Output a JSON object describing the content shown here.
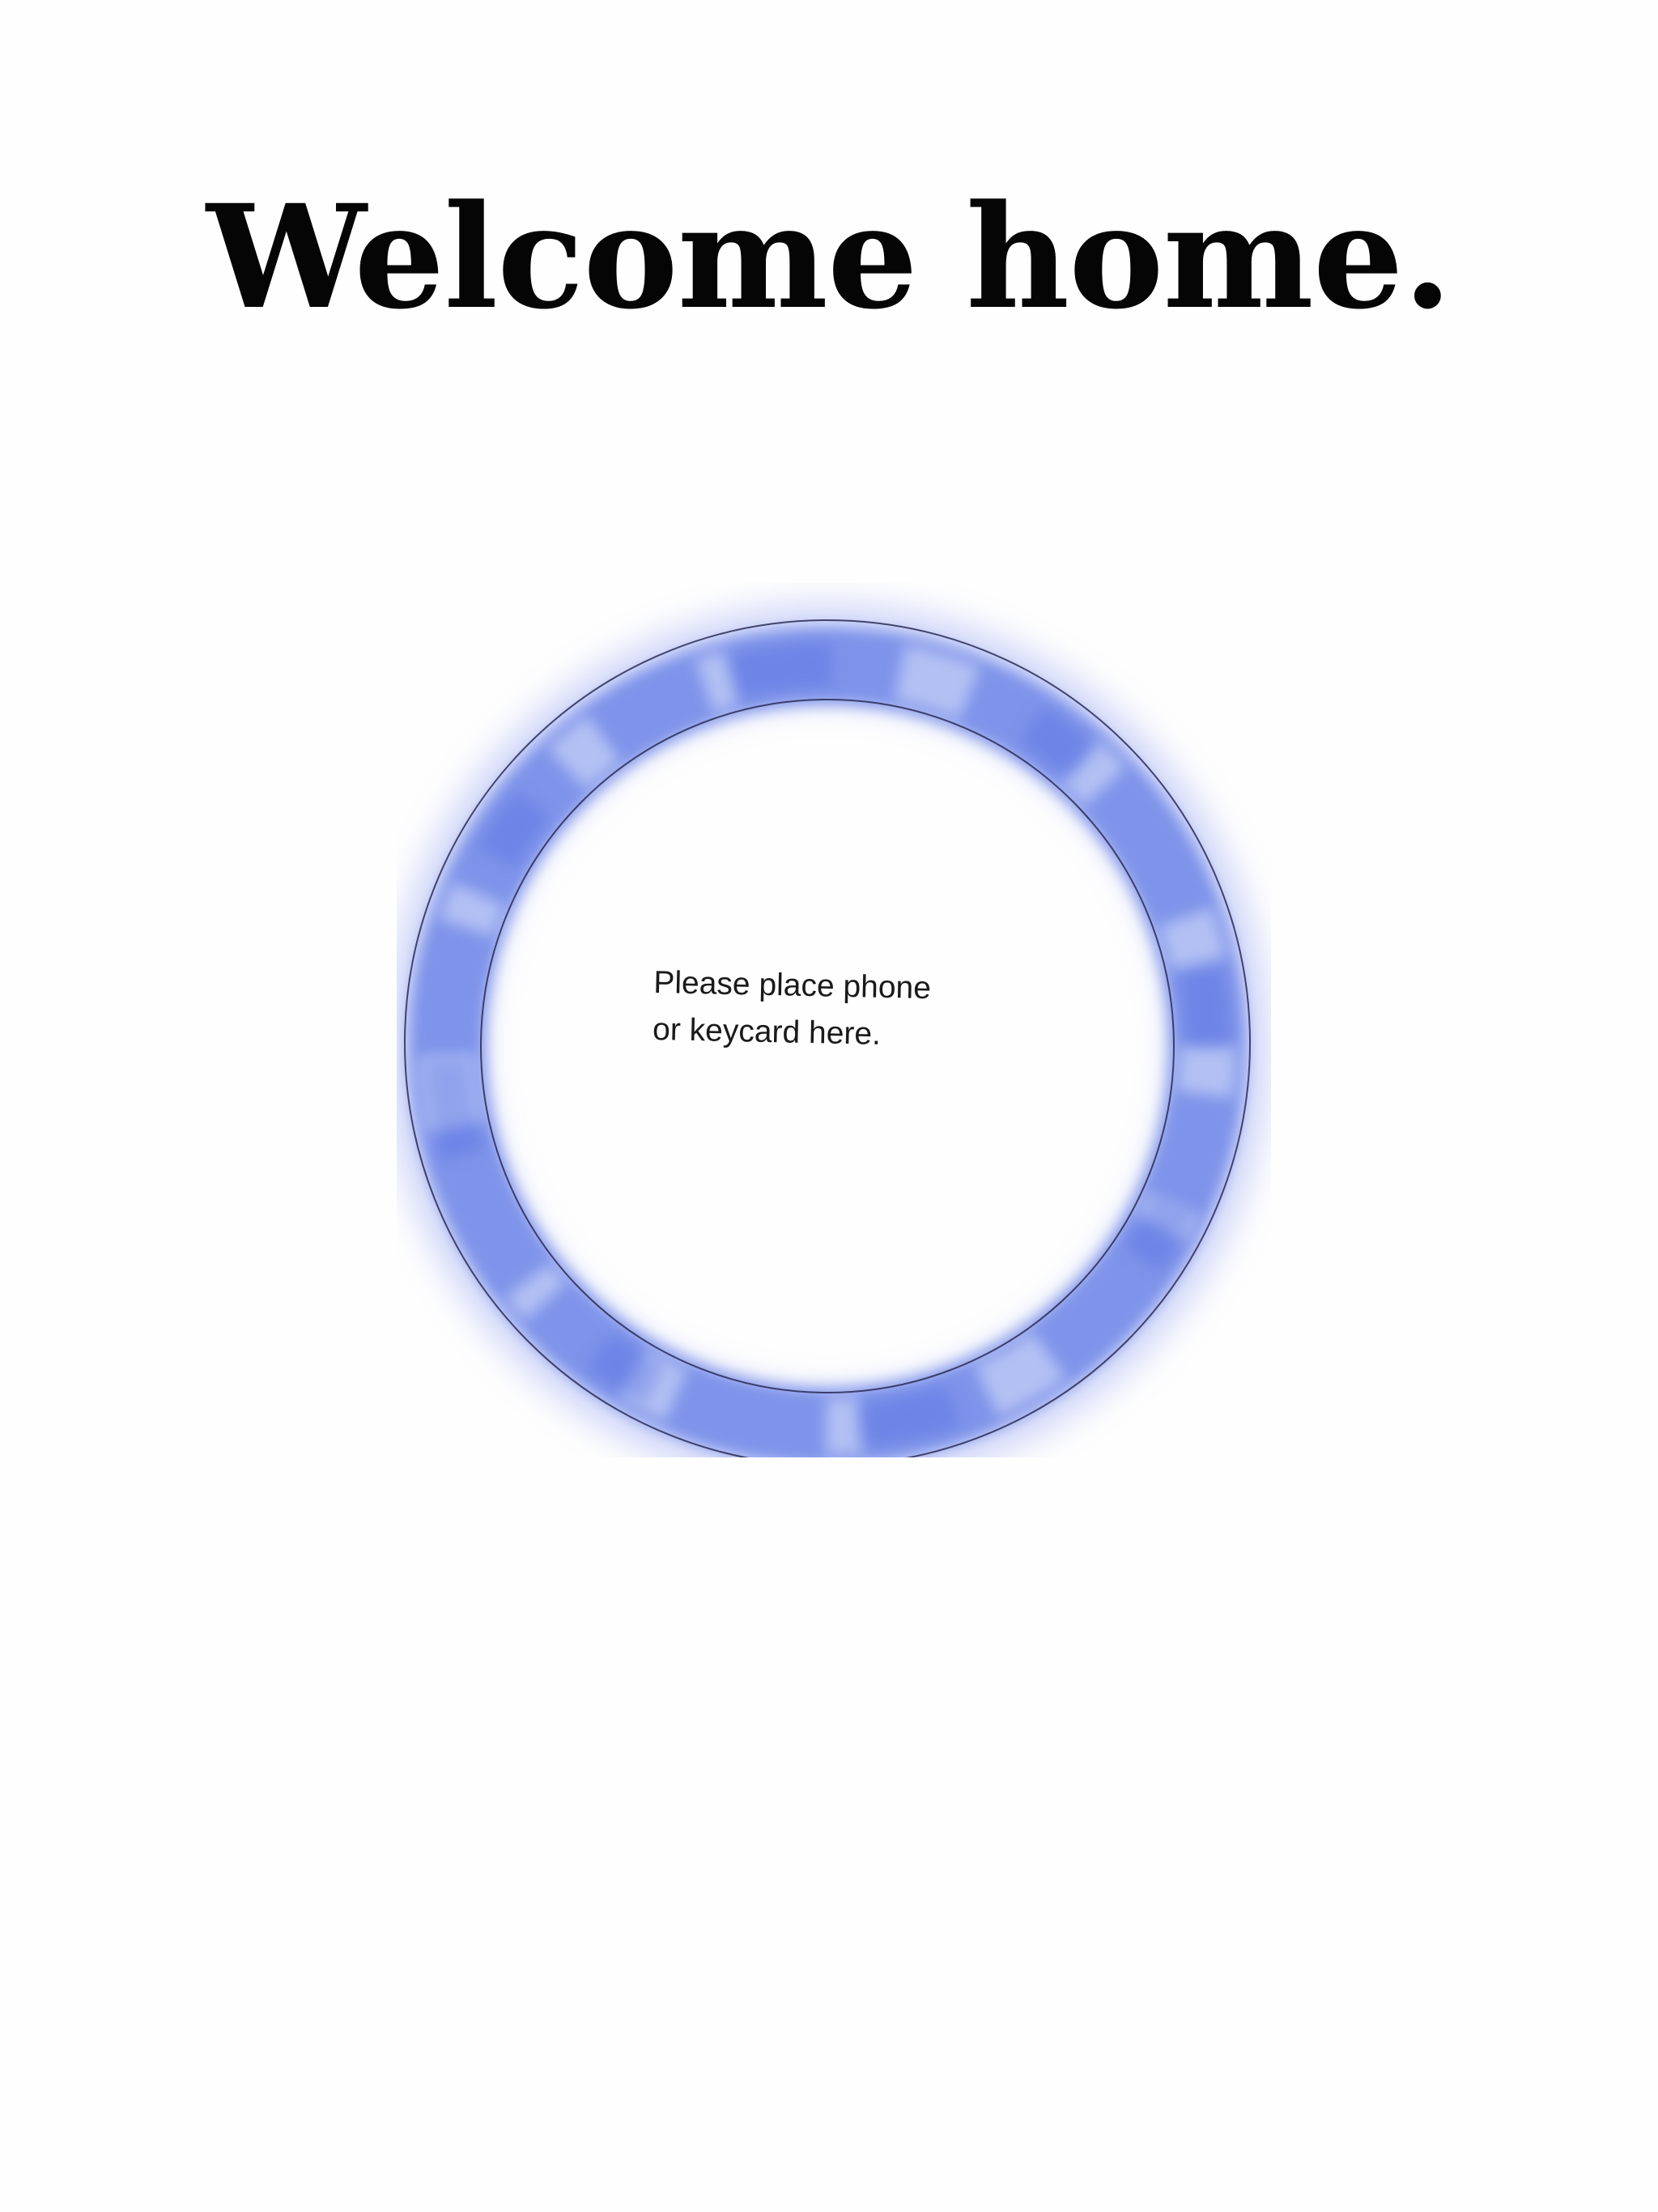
{
  "screen": {
    "title": "Welcome home.",
    "reader": {
      "prompt_line_1": "Please place phone",
      "prompt_line_2": "or keycard here.",
      "ring_color": "#6f86e8",
      "icon": "nfc-reader-ring-icon"
    }
  }
}
